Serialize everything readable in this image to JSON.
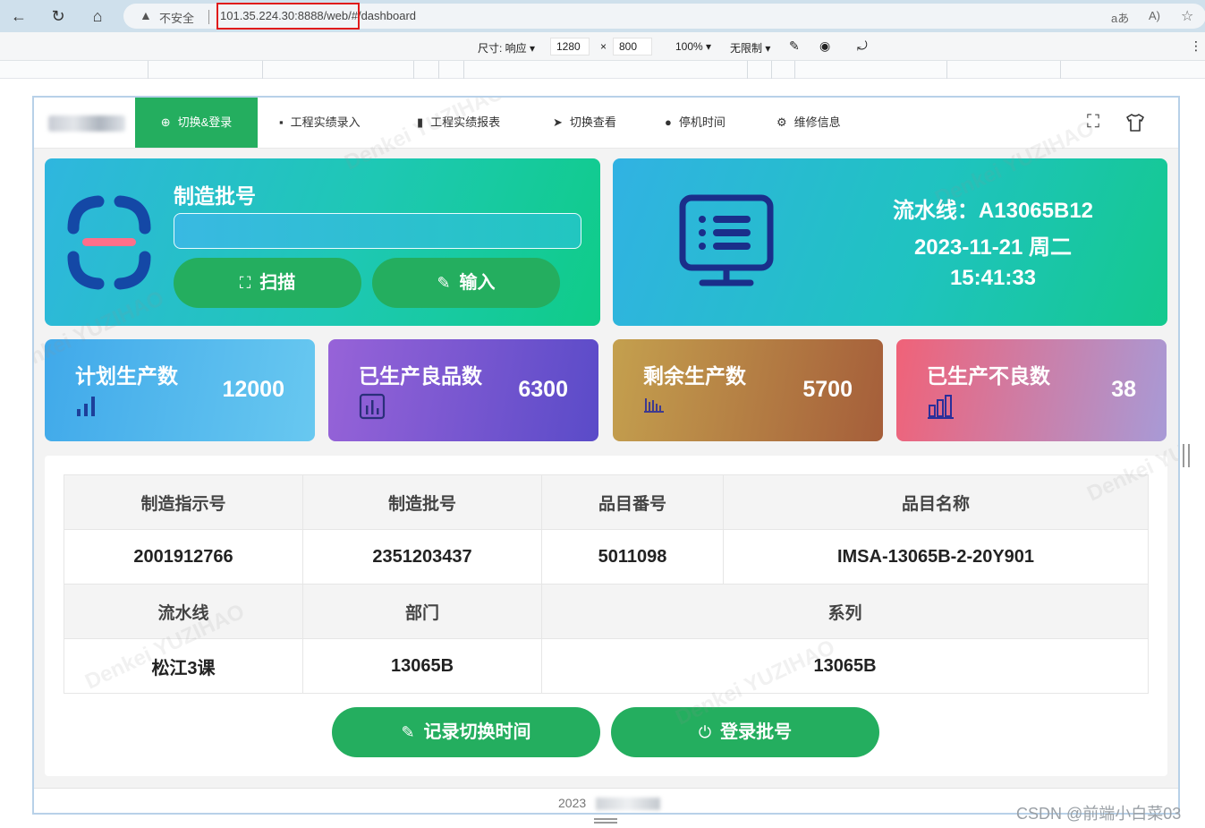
{
  "browser": {
    "security_label": "不安全",
    "url": "101.35.224.30:8888/web/#/dashboard"
  },
  "devtools": {
    "size_label": "尺寸: 响应 ▾",
    "width_value": "1280",
    "times": "×",
    "height_value": "800",
    "zoom": "100% ▾",
    "throttle": "无限制 ▾"
  },
  "nav": {
    "items": [
      {
        "label": "切换&登录",
        "icon": "plus-circle-icon"
      },
      {
        "label": "工程实绩录入",
        "icon": "comment-icon"
      },
      {
        "label": "工程实绩报表",
        "icon": "bar-chart-icon"
      },
      {
        "label": "切换查看",
        "icon": "send-icon"
      },
      {
        "label": "停机时间",
        "icon": "info-circle-icon"
      },
      {
        "label": "维修信息",
        "icon": "gear-icon"
      }
    ]
  },
  "batch_card": {
    "title": "制造批号",
    "input_value": "",
    "scan_label": "扫描",
    "input_label": "输入"
  },
  "line_card": {
    "line": "流水线：A13065B12",
    "date": "2023-11-21 周二",
    "time": "15:41:33"
  },
  "stats": [
    {
      "label": "计划生产数",
      "value": "12000",
      "icon": "signal-bars-icon"
    },
    {
      "label": "已生产良品数",
      "value": "6300",
      "icon": "chart-box-icon"
    },
    {
      "label": "剩余生产数",
      "value": "5700",
      "icon": "histogram-icon"
    },
    {
      "label": "已生产不良数",
      "value": "38",
      "icon": "column-chart-icon"
    }
  ],
  "table": {
    "row1_headers": [
      "制造指示号",
      "制造批号",
      "品目番号",
      "品目名称"
    ],
    "row1_values": [
      "2001912766",
      "2351203437",
      "5011098",
      "IMSA-13065B-2-20Y901"
    ],
    "row2_headers": [
      "流水线",
      "部门",
      "系列"
    ],
    "row2_values": [
      "松江3课",
      "13065B",
      "13065B"
    ]
  },
  "actions": {
    "record_label": "记录切换时间",
    "login_label": "登录批号"
  },
  "footer": {
    "year": "2023"
  },
  "watermark": "Denkei YUZIHAO",
  "csdn": "CSDN @前端小白菜03",
  "colors": {
    "primary_green": "#24ae5f",
    "url_highlight": "#e01b1b"
  }
}
